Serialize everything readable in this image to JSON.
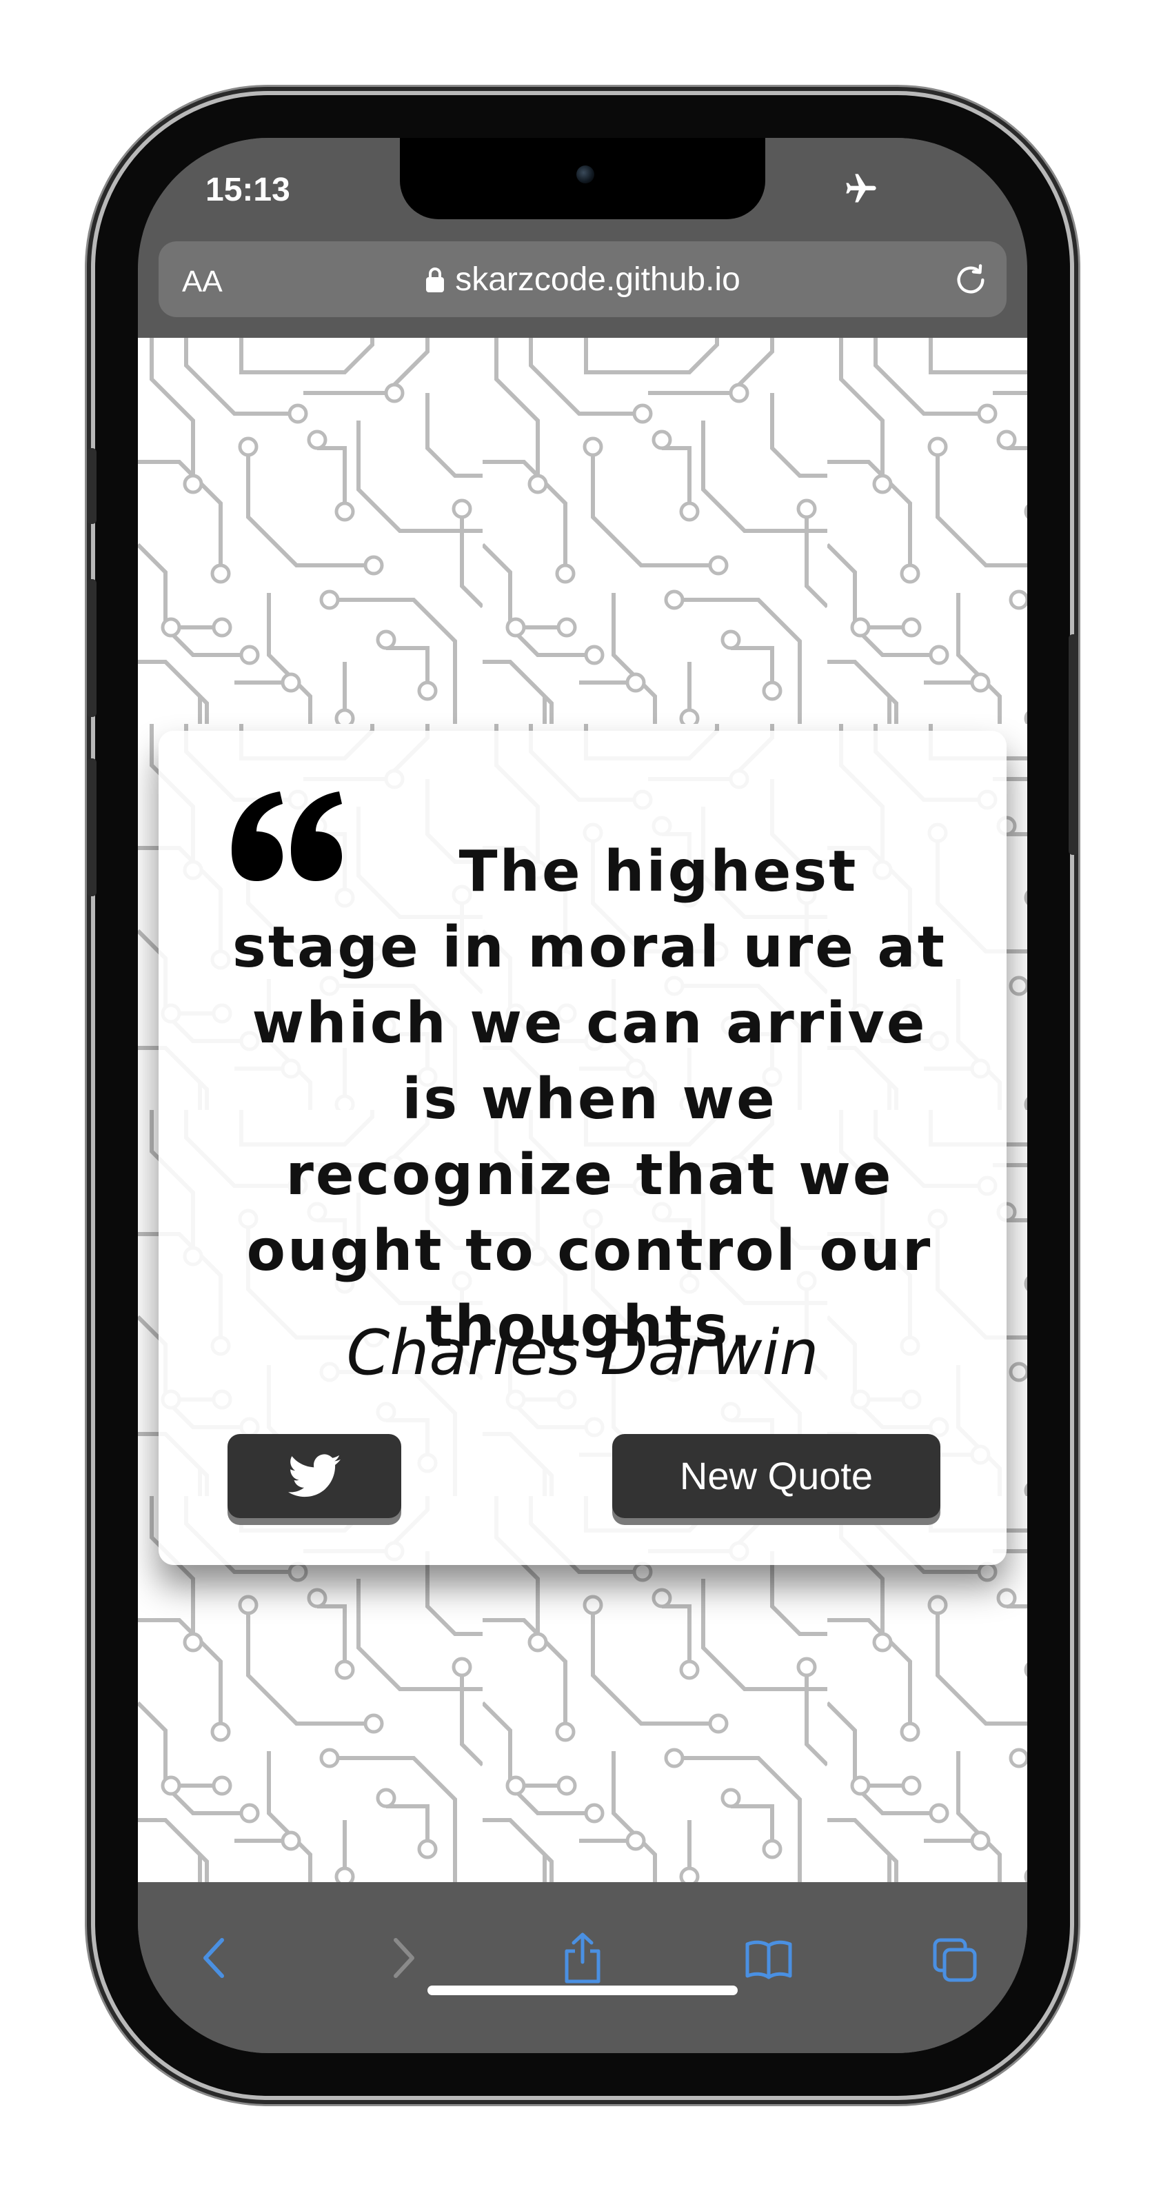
{
  "status_bar": {
    "time": "15:13",
    "airplane_icon": "airplane-icon"
  },
  "address_bar": {
    "text_size_label": "AA",
    "url": "skarzcode.github.io",
    "lock_icon": "lock-icon",
    "reload_icon": "reload-icon"
  },
  "quote_card": {
    "quote_icon": "quote-open-icon",
    "quote": "The highest stage in moral ure at which we can arrive is when we recognize that we ought to control our thoughts.",
    "author": "Charles Darwin",
    "tweet_button_icon": "twitter-icon",
    "new_quote_label": "New Quote"
  },
  "toolbar": {
    "items": [
      "back-icon",
      "forward-icon",
      "share-icon",
      "bookmarks-icon",
      "tabs-icon"
    ]
  },
  "colors": {
    "browser_chrome": "#595959",
    "address_bar": "#737373",
    "button": "#333333",
    "toolbar_icon_accent": "#4a90e2",
    "circuit_line": "#bbbbbb"
  }
}
